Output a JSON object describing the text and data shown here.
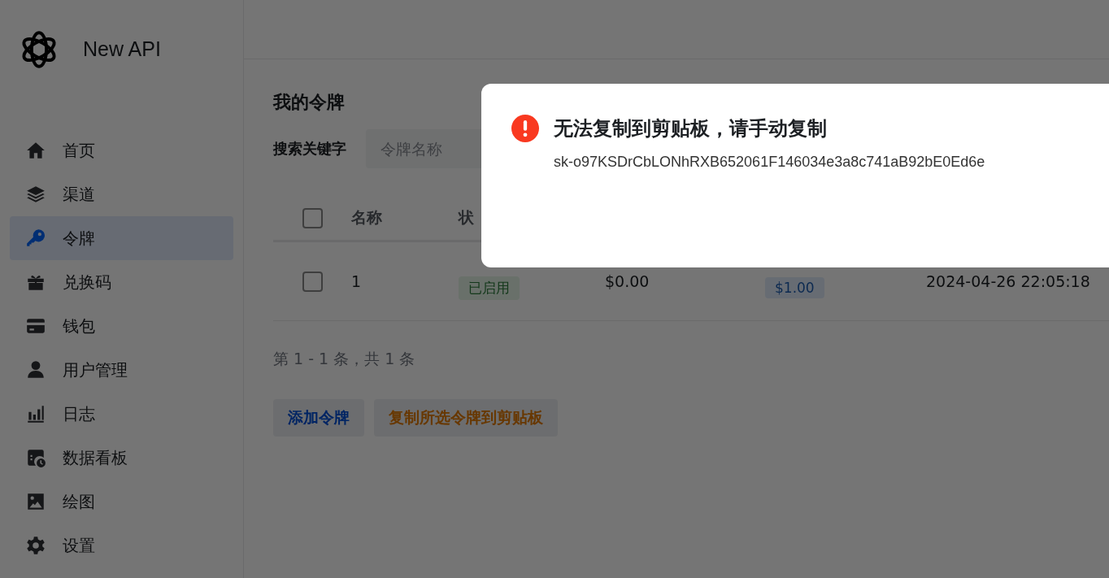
{
  "brand": {
    "name": "New API"
  },
  "sidebar": {
    "items": [
      {
        "label": "首页",
        "kind": "home",
        "selected": false
      },
      {
        "label": "渠道",
        "kind": "layers",
        "selected": false
      },
      {
        "label": "令牌",
        "kind": "key",
        "selected": true
      },
      {
        "label": "兑换码",
        "kind": "gift",
        "selected": false
      },
      {
        "label": "钱包",
        "kind": "card",
        "selected": false
      },
      {
        "label": "用户管理",
        "kind": "user",
        "selected": false
      },
      {
        "label": "日志",
        "kind": "chart",
        "selected": false
      },
      {
        "label": "数据看板",
        "kind": "dashboard",
        "selected": false
      },
      {
        "label": "绘图",
        "kind": "image",
        "selected": false
      },
      {
        "label": "设置",
        "kind": "gear",
        "selected": false
      }
    ]
  },
  "page": {
    "title": "我的令牌",
    "search": {
      "label": "搜索关键字",
      "placeholder": "令牌名称"
    }
  },
  "table": {
    "header_checked": false,
    "columns": [
      "名称",
      "状"
    ],
    "rows": [
      {
        "checked": false,
        "name": "1",
        "status": "已启用",
        "used": "$0.00",
        "quota": "$1.00",
        "created": "2024-04-26 22:05:18"
      }
    ]
  },
  "pagination": "第 1 - 1 条，共 1 条",
  "buttons": [
    {
      "label": "添加令牌",
      "kind": "primary"
    },
    {
      "label": "复制所选令牌到剪贴板",
      "kind": "warning"
    }
  ],
  "dialog": {
    "kind": "error",
    "title": "无法复制到剪贴板，请手动复制",
    "message": "sk-o97KSDrCbLONhRXB652061F146034e3a8c741aB92bE0Ed6e"
  }
}
